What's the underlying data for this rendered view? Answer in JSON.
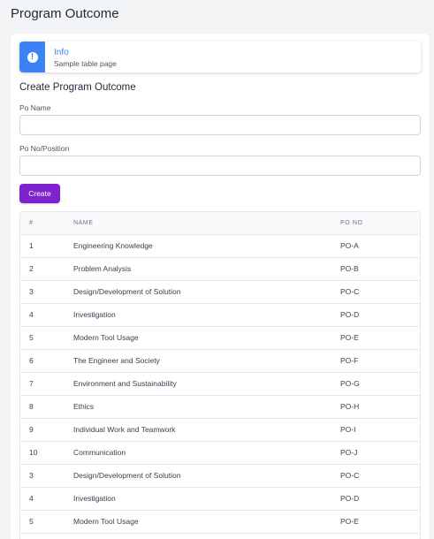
{
  "page": {
    "title": "Program Outcome"
  },
  "alert": {
    "icon": "info-icon",
    "title": "Info",
    "text": "Sample table page"
  },
  "form": {
    "title": "Create Program Outcome",
    "po_name_label": "Po Name",
    "po_name_value": "",
    "po_position_label": "Po No/Position",
    "po_position_value": "",
    "create_label": "Create"
  },
  "colors": {
    "accent": "#7e22ce",
    "info": "#3b82f6"
  },
  "table": {
    "headers": [
      "#",
      "NAME",
      "PO NO"
    ],
    "rows": [
      {
        "no": "1",
        "name": "Engineering Knowledge",
        "po": "PO-A"
      },
      {
        "no": "2",
        "name": "Problem Analysis",
        "po": "PO-B"
      },
      {
        "no": "3",
        "name": "Design/Development of Solution",
        "po": "PO-C"
      },
      {
        "no": "4",
        "name": "Investigation",
        "po": "PO-D"
      },
      {
        "no": "5",
        "name": "Modern Tool Usage",
        "po": "PO-E"
      },
      {
        "no": "6",
        "name": "The Engineer and Society",
        "po": "PO-F"
      },
      {
        "no": "7",
        "name": "Environment and Sustainability",
        "po": "PO-G"
      },
      {
        "no": "8",
        "name": "Ethics",
        "po": "PO-H"
      },
      {
        "no": "9",
        "name": "Individual Work and Teamwork",
        "po": "PO-I"
      },
      {
        "no": "10",
        "name": "Communication",
        "po": "PO-J"
      },
      {
        "no": "3",
        "name": "Design/Development of Solution",
        "po": "PO-C"
      },
      {
        "no": "4",
        "name": "Investigation",
        "po": "PO-D"
      },
      {
        "no": "5",
        "name": "Modern Tool Usage",
        "po": "PO-E"
      }
    ]
  }
}
